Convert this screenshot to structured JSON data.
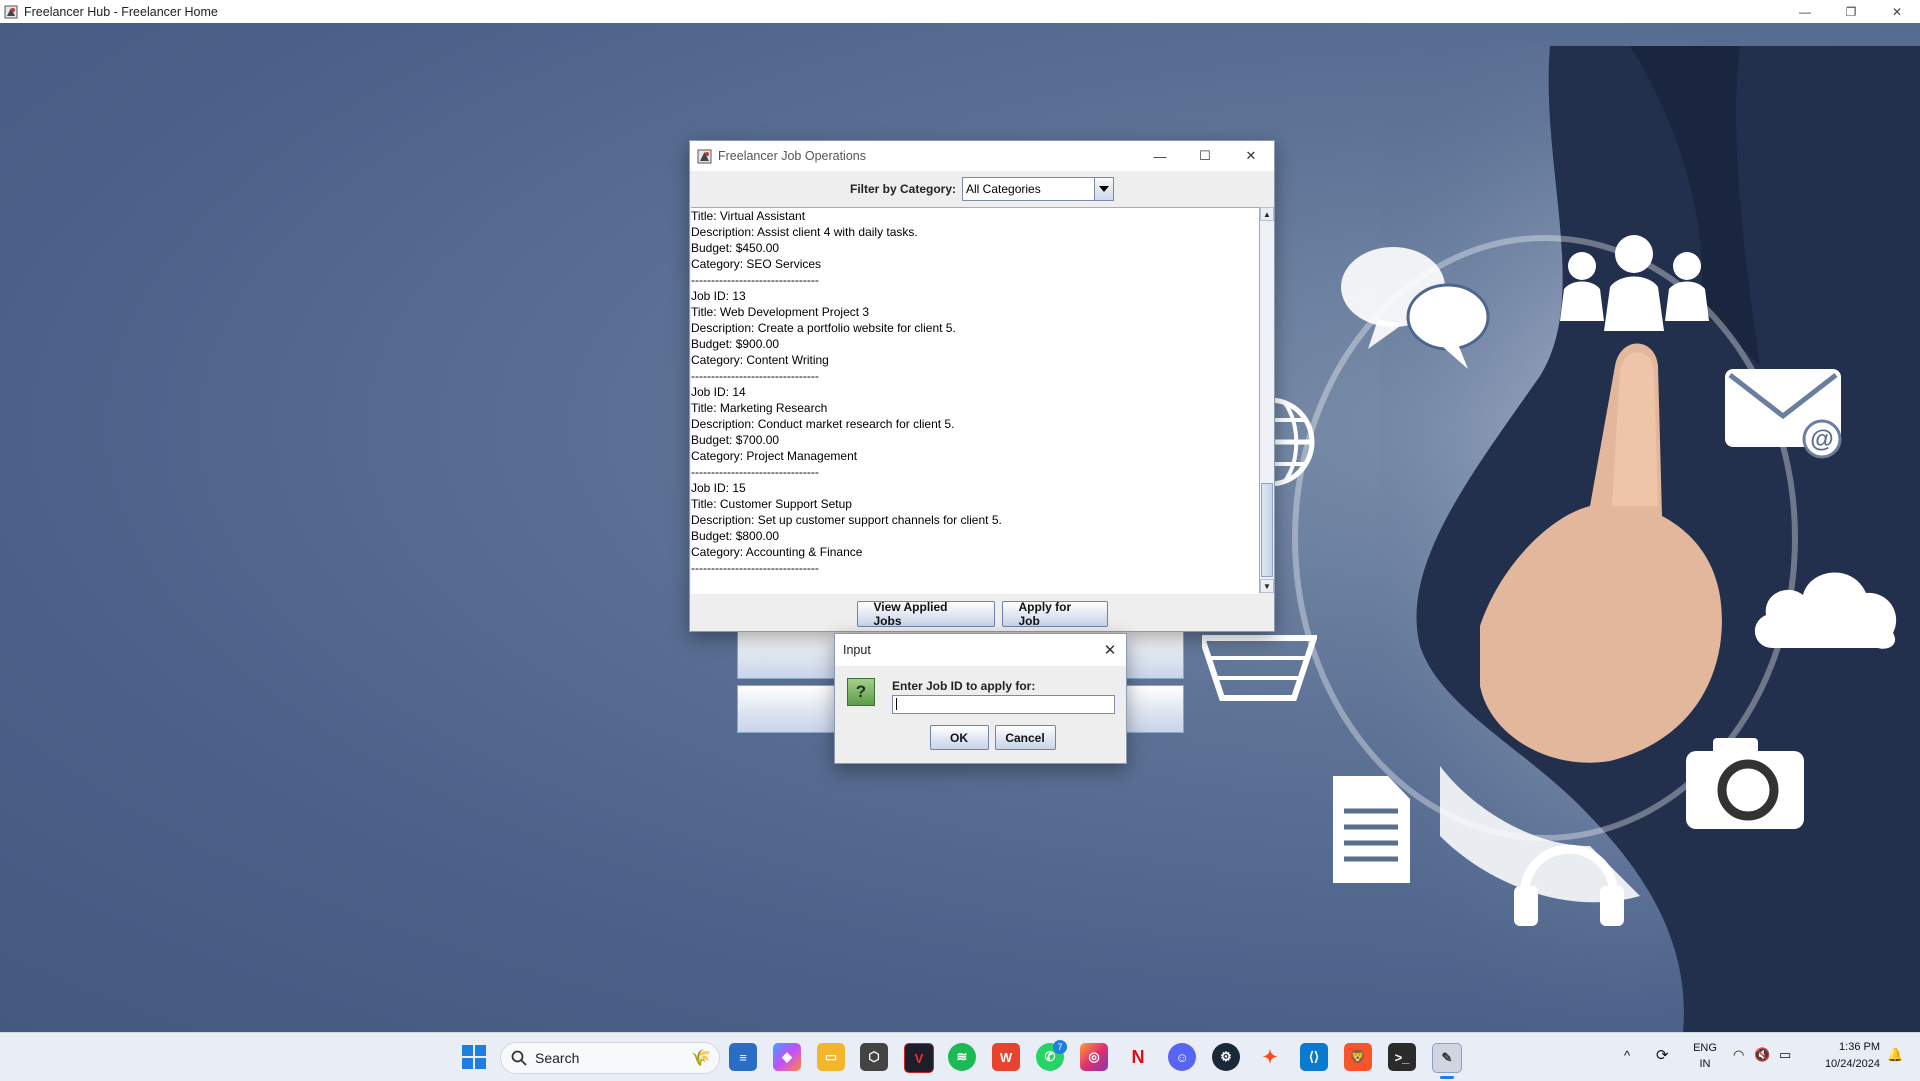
{
  "app": {
    "title": "Freelancer Hub - Freelancer Home"
  },
  "job_window": {
    "title": "Freelancer Job Operations",
    "filter_label": "Filter by Category:",
    "filter_value": "All Categories",
    "lines": [
      "Title: Virtual Assistant",
      "Description: Assist client 4 with daily tasks.",
      "Budget: $450.00",
      "Category: SEO Services",
      "--------------------------------",
      "Job ID: 13",
      "Title: Web Development Project 3",
      "Description: Create a portfolio website for client 5.",
      "Budget: $900.00",
      "Category: Content Writing",
      "--------------------------------",
      "Job ID: 14",
      "Title: Marketing Research",
      "Description: Conduct market research for client 5.",
      "Budget: $700.00",
      "Category: Project Management",
      "--------------------------------",
      "Job ID: 15",
      "Title: Customer Support Setup",
      "Description: Set up customer support channels for client 5.",
      "Budget: $800.00",
      "Category: Accounting & Finance",
      "--------------------------------"
    ],
    "view_applied_label": "View Applied Jobs",
    "apply_label": "Apply for Job"
  },
  "input_dialog": {
    "title": "Input",
    "prompt": "Enter Job ID to apply for:",
    "value": "",
    "ok_label": "OK",
    "cancel_label": "Cancel"
  },
  "taskbar": {
    "search_label": "Search",
    "lang_top": "ENG",
    "lang_bottom": "IN",
    "time": "1:36 PM",
    "date": "10/24/2024",
    "whatsapp_badge": "7"
  }
}
